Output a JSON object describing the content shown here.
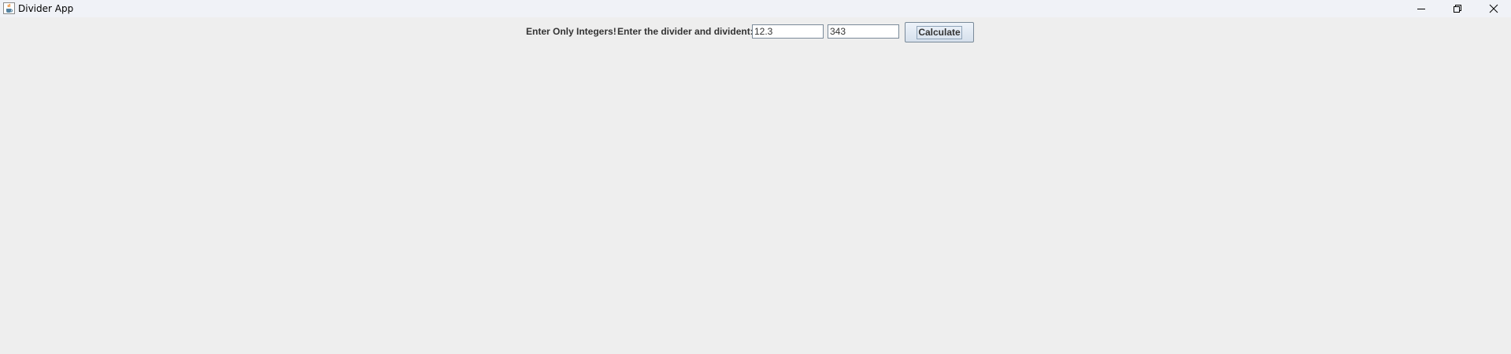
{
  "window": {
    "title": "Divider App",
    "app_icon": "java-cup-icon",
    "controls": {
      "minimize_icon": "minimize-icon",
      "maximize_icon": "restore-icon",
      "close_icon": "close-icon"
    }
  },
  "form": {
    "label_warning": "Enter Only Integers!",
    "label_prompt": "Enter the divider and divident:",
    "divider_value": "12.3",
    "divident_value": "343",
    "calculate_label": "Calculate"
  },
  "colors": {
    "background": "#eeeeee",
    "titlebar": "#f0f2f7",
    "label_text": "#333333"
  }
}
